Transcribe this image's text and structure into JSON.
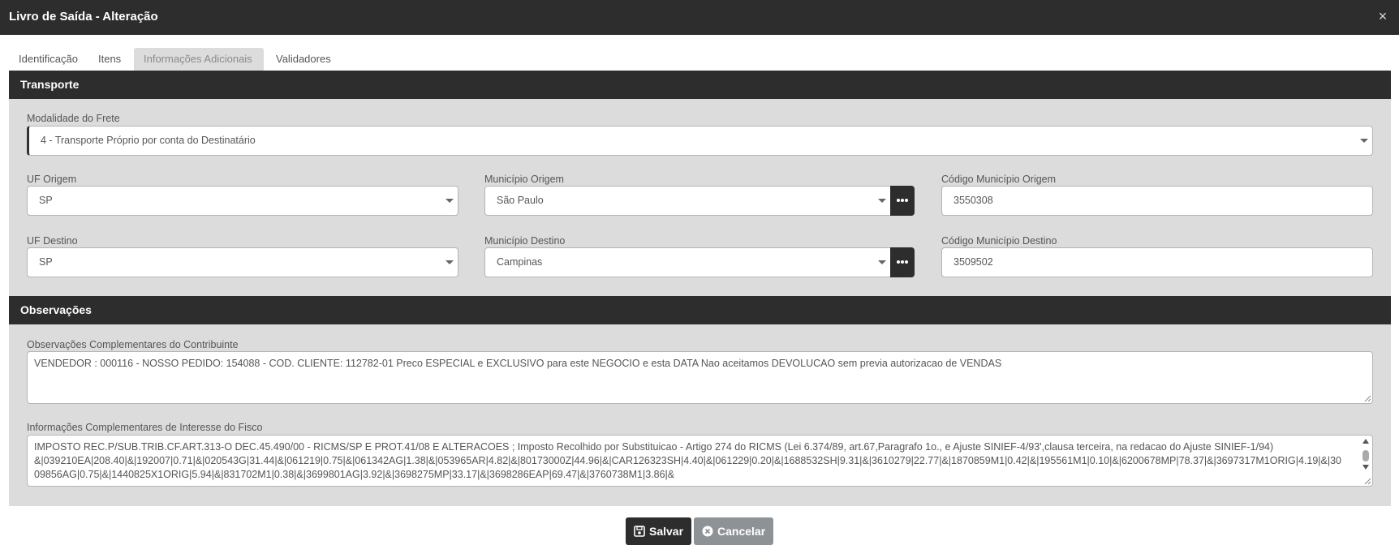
{
  "window": {
    "title": "Livro de Saída - Alteração",
    "close_glyph": "×"
  },
  "tabs": [
    {
      "label": "Identificação",
      "active": false
    },
    {
      "label": "Itens",
      "active": false
    },
    {
      "label": "Informações Adicionais",
      "active": true
    },
    {
      "label": "Validadores",
      "active": false
    }
  ],
  "transporte": {
    "header": "Transporte",
    "modalidade": {
      "label": "Modalidade do Frete",
      "value": "4 - Transporte Próprio por conta do Destinatário"
    },
    "uf_origem": {
      "label": "UF Origem",
      "value": "SP"
    },
    "municipio_origem": {
      "label": "Município Origem",
      "value": "São Paulo"
    },
    "codigo_municipio_origem": {
      "label": "Código Município Origem",
      "value": "3550308"
    },
    "uf_destino": {
      "label": "UF Destino",
      "value": "SP"
    },
    "municipio_destino": {
      "label": "Município Destino",
      "value": "Campinas"
    },
    "codigo_municipio_destino": {
      "label": "Código Município Destino",
      "value": "3509502"
    }
  },
  "observacoes": {
    "header": "Observações",
    "contribuinte": {
      "label": "Observações Complementares do Contribuinte",
      "value": "VENDEDOR : 000116 - NOSSO PEDIDO: 154088 - COD. CLIENTE: 112782-01 Preco ESPECIAL e EXCLUSIVO para este NEGOCIO e esta DATA Nao aceitamos DEVOLUCAO sem previa autorizacao de VENDAS"
    },
    "fisco": {
      "label": "Informações Complementares de Interesse do Fisco",
      "line1": "IMPOSTO REC.P/SUB.TRIB.CF.ART.313-O DEC.45.490/00 - RICMS/SP E PROT.41/08 E ALTERACOES ; Imposto Recolhido por Substituicao - Artigo 274 do RICMS (Lei 6.374/89, art.67,Paragrafo 1o., e Ajuste SINIEF-4/93',clausa terceira, na redacao do Ajuste SINIEF-1/94)",
      "line2": "&|039210EA|208.40|&|192007|0.71|&|020543G|31.44|&|061219|0.75|&|061342AG|1.38|&|053965AR|4.82|&|80173000Z|44.96|&|CAR126323SH|4.40|&|061229|0.20|&|1688532SH|9.31|&|3610279|22.77|&|1870859M1|0.42|&|195561M1|0.10|&|6200678MP|78.37|&|3697317M1ORIG|4.19|&|30",
      "line3": "09856AG|0.75|&|1440825X1ORIG|5.94|&|831702M1|0.38|&|3699801AG|3.92|&|3698275MP|33.17|&|3698286EAP|69.47|&|3760738M1|3.86|&"
    }
  },
  "actions": {
    "save_label": "Salvar",
    "cancel_label": "Cancelar"
  }
}
